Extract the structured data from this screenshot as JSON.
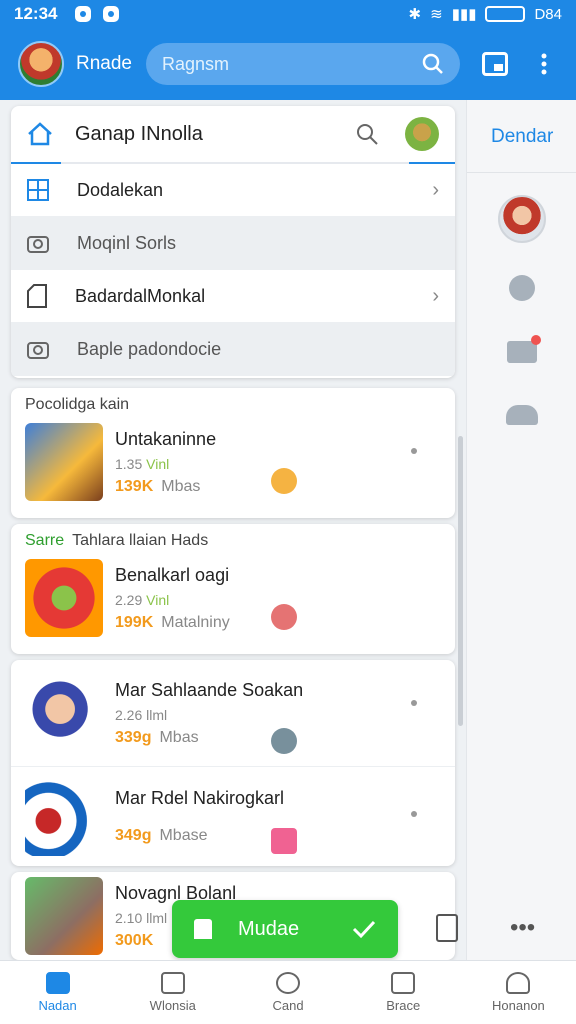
{
  "status_bar": {
    "time": "12:34",
    "right_text": "D84",
    "icons": [
      "bluetooth-icon",
      "wifi-icon",
      "signal-icon",
      "battery-icon"
    ]
  },
  "app_bar": {
    "app_name": "Rnade",
    "search_placeholder": "Ragnsm",
    "icons": [
      "search-icon",
      "tabs-icon",
      "more-vert-icon"
    ]
  },
  "side_panel": {
    "title": "Dendar",
    "icons": [
      "avatar",
      "pin-icon",
      "mail-icon",
      "people-icon"
    ]
  },
  "menu_card": {
    "title": "Ganap INnolla",
    "rows": [
      {
        "label": "Dodalekan",
        "icon": "grid-icon",
        "chevron": true
      },
      {
        "label": "Moqinl Sorls",
        "icon": "camera-icon",
        "chevron": false
      },
      {
        "label": "BadardalMonkal",
        "icon": "file-icon",
        "chevron": true
      },
      {
        "label": "Baple padondocie",
        "icon": "camera-icon",
        "chevron": false
      }
    ]
  },
  "lists": [
    {
      "section": "Pocolidga kain",
      "section_prefix": "",
      "apps": [
        {
          "name": "Untakaninne",
          "meta_size": "1.35",
          "meta_v": "Vinl",
          "stat_num": "139K",
          "stat_label": "Mbas",
          "badge_color": "#f5b342"
        }
      ]
    },
    {
      "section": "Tahlara llaian Hads",
      "section_prefix": "Sarre",
      "apps": [
        {
          "name": "Benalkarl oagi",
          "meta_size": "2.29",
          "meta_v": "Vinl",
          "stat_num": "199K",
          "stat_label": "Matalniny",
          "badge_color": "#e57373"
        }
      ]
    },
    {
      "section": "",
      "section_prefix": "",
      "apps": [
        {
          "name": "Mar Sahlaande Soakan",
          "meta_size": "2.26",
          "meta_v": "llml",
          "stat_num": "339g",
          "stat_label": "Mbas",
          "badge_color": "#78909c"
        },
        {
          "name": "Mar Rdel Nakirogkarl",
          "meta_size": "",
          "meta_v": "",
          "stat_num": "349g",
          "stat_label": "Mbase",
          "badge_color": "#f06292"
        }
      ]
    },
    {
      "section": "",
      "section_prefix": "",
      "apps": [
        {
          "name": "Novagnl Bolanl",
          "meta_size": "2.10",
          "meta_v": "llml",
          "stat_num": "300K",
          "stat_label": "",
          "badge_color": "#ec407a"
        }
      ]
    }
  ],
  "fab": {
    "label": "Mudae"
  },
  "bottom_nav": [
    {
      "label": "Nadan",
      "active": true,
      "icon": "home-icon"
    },
    {
      "label": "Wlonsia",
      "active": false,
      "icon": "store-icon"
    },
    {
      "label": "Cand",
      "active": false,
      "icon": "chart-icon"
    },
    {
      "label": "Brace",
      "active": false,
      "icon": "shield-icon"
    },
    {
      "label": "Honanon",
      "active": false,
      "icon": "profile-icon"
    }
  ]
}
